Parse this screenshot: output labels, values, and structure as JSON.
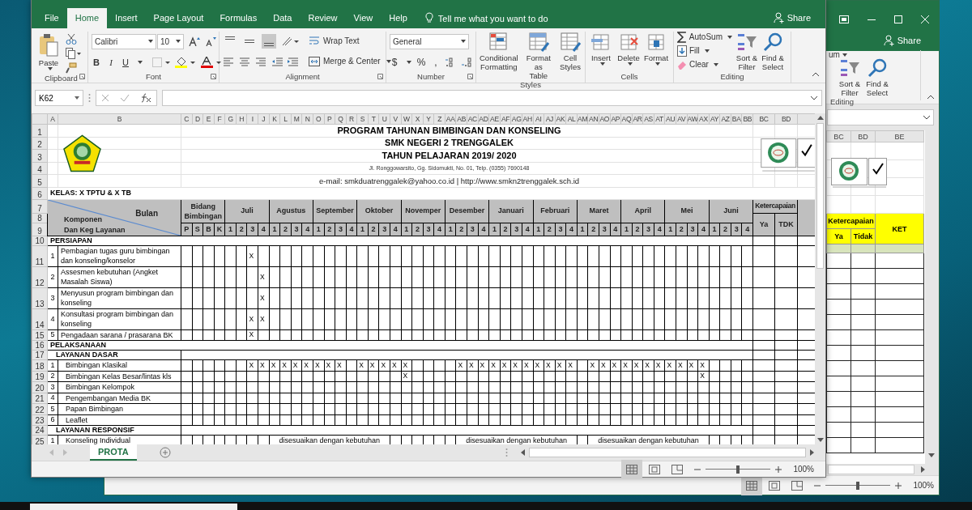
{
  "window": {
    "tabs": [
      {
        "label": "File",
        "selected": false
      },
      {
        "label": "Home",
        "selected": true
      },
      {
        "label": "Insert",
        "selected": false
      },
      {
        "label": "Page Layout",
        "selected": false
      },
      {
        "label": "Formulas",
        "selected": false
      },
      {
        "label": "Data",
        "selected": false
      },
      {
        "label": "Review",
        "selected": false
      },
      {
        "label": "View",
        "selected": false
      },
      {
        "label": "Help",
        "selected": false
      }
    ],
    "tell_me": "Tell me what you want to do",
    "share": "Share"
  },
  "ribbon": {
    "groups": [
      {
        "kind": "clipboard",
        "label": "Clipboard",
        "paste": "Paste"
      },
      {
        "kind": "font",
        "label": "Font",
        "font_name": "Calibri",
        "font_size": "10",
        "bold": "B",
        "italic": "I",
        "underline": "U"
      },
      {
        "kind": "alignment",
        "label": "Alignment",
        "wrap": "Wrap Text",
        "merge": "Merge & Center",
        "vertical_align": [
          {
            "selected": false
          },
          {
            "selected": false
          },
          {
            "selected": true
          }
        ]
      },
      {
        "kind": "number",
        "label": "Number",
        "format": "General",
        "currency": "$",
        "percent": "%",
        "comma": ","
      },
      {
        "kind": "styles",
        "label": "Styles",
        "buttons": [
          "Conditional\nFormatting",
          "Format as\nTable",
          "Cell\nStyles"
        ]
      },
      {
        "kind": "cells",
        "label": "Cells",
        "buttons": [
          "Insert",
          "Delete",
          "Format"
        ]
      },
      {
        "kind": "editing",
        "label": "Editing",
        "items": [
          "AutoSum",
          "Fill",
          "Clear"
        ],
        "buttons": [
          "Sort &\nFilter",
          "Find &\nSelect"
        ]
      }
    ]
  },
  "formula_bar": {
    "name_box": "K62"
  },
  "sheet": {
    "column_headers": [
      "A",
      "B",
      "C",
      "D",
      "E",
      "F",
      "G",
      "H",
      "I",
      "J",
      "K",
      "L",
      "M",
      "N",
      "O",
      "P",
      "Q",
      "R",
      "S",
      "T",
      "U",
      "V",
      "W",
      "X",
      "Y",
      "Z",
      "AA",
      "AB",
      "AC",
      "AD",
      "AE",
      "AF",
      "AG",
      "AH",
      "AI",
      "AJ",
      "AK",
      "AL",
      "AM",
      "AN",
      "AO",
      "AP",
      "AQ",
      "AR",
      "AS",
      "AT",
      "AU",
      "AV",
      "AW",
      "AX",
      "AY",
      "AZ",
      "BA",
      "BB",
      "BC",
      "BD"
    ],
    "top_rows": [
      {
        "n": "1",
        "kind": "title",
        "text": "PROGRAM TAHUNAN BIMBINGAN DAN KONSELING"
      },
      {
        "n": "2",
        "kind": "title",
        "text": "SMK NEGERI 2 TRENGGALEK"
      },
      {
        "n": "3",
        "kind": "title",
        "text": "TAHUN PELAJARAN 2019/ 2020"
      },
      {
        "n": "4",
        "kind": "address",
        "text": "Jl. Ronggowarsito, Gg. Sidomukti, No. 01, Telp. (0355) 7690148"
      },
      {
        "n": "5",
        "kind": "contact",
        "text": "e-mail: smkduatrenggalek@yahoo.co.id | http://www.smkn2trenggalek.sch.id"
      },
      {
        "n": "6",
        "kind": "class",
        "text": "KELAS: X TPTU & X TB"
      }
    ],
    "header": {
      "row_numbers": [
        "7",
        "8",
        "9"
      ],
      "corner_top": "Bulan",
      "corner_bottom": "Komponen\nDan Keg Layanan",
      "field_group": "Bidang Bimbingan",
      "fields": [
        "P",
        "S",
        "B",
        "K"
      ],
      "months": [
        {
          "name": "Juli",
          "weeks": [
            "1",
            "2",
            "3",
            "4"
          ]
        },
        {
          "name": "Agustus",
          "weeks": [
            "1",
            "2",
            "3",
            "4"
          ]
        },
        {
          "name": "September",
          "weeks": [
            "1",
            "2",
            "3",
            "4"
          ]
        },
        {
          "name": "Oktober",
          "weeks": [
            "1",
            "2",
            "3",
            "4"
          ]
        },
        {
          "name": "Novemper",
          "weeks": [
            "1",
            "2",
            "3",
            "4"
          ]
        },
        {
          "name": "Desember",
          "weeks": [
            "1",
            "2",
            "3",
            "4"
          ]
        },
        {
          "name": "Januari",
          "weeks": [
            "1",
            "2",
            "3",
            "4"
          ]
        },
        {
          "name": "Februari",
          "weeks": [
            "1",
            "2",
            "3",
            "4"
          ]
        },
        {
          "name": "Maret",
          "weeks": [
            "1",
            "2",
            "3",
            "4"
          ]
        },
        {
          "name": "April",
          "weeks": [
            "1",
            "2",
            "3",
            "4"
          ]
        },
        {
          "name": "Mei",
          "weeks": [
            "1",
            "2",
            "3",
            "4"
          ]
        },
        {
          "name": "Juni",
          "weeks": [
            "1",
            "2",
            "3",
            "4"
          ]
        }
      ],
      "achievement": "Ketercapaian",
      "yes": "Ya",
      "no": "TDK"
    },
    "body_rows": [
      {
        "n": "10",
        "kind": "section",
        "text": "PERSIAPAN"
      },
      {
        "n": "11",
        "kind": "item",
        "no": "1",
        "label": "Pembagian tugas guru bimbingan dan konseling/konselor",
        "cells": [
          {},
          {},
          {},
          {},
          {},
          {},
          {
            "text": "X"
          }
        ]
      },
      {
        "n": "12",
        "kind": "item",
        "no": "2",
        "label": "Assesmen kebutuhan (Angket Masalah Siswa)",
        "cells": [
          {},
          {},
          {},
          {},
          {},
          {},
          {},
          {
            "text": "X"
          }
        ]
      },
      {
        "n": "13",
        "kind": "item",
        "no": "3",
        "label": "Menyusun program bimbingan dan konseling",
        "cells": [
          {},
          {},
          {},
          {},
          {},
          {},
          {},
          {
            "text": "X"
          }
        ]
      },
      {
        "n": "14",
        "kind": "item",
        "no": "4",
        "label": "Konsultasi program bimbingan dan konseling",
        "cells": [
          {},
          {},
          {},
          {},
          {},
          {},
          {
            "text": "X"
          },
          {
            "text": "X"
          }
        ]
      },
      {
        "n": "15",
        "kind": "item",
        "no": "5",
        "label": "Pengadaan sarana / prasarana BK",
        "cells": [
          {},
          {},
          {},
          {},
          {},
          {},
          {
            "text": "X"
          }
        ]
      },
      {
        "n": "16",
        "kind": "section",
        "text": "PELAKSANAAN"
      },
      {
        "n": "17",
        "kind": "subsection",
        "text": "LAYANAN DASAR"
      },
      {
        "n": "18",
        "kind": "activity",
        "no": "1",
        "label": "Bimbingan Klasikal",
        "cells": [
          {},
          {},
          {},
          {},
          {},
          {},
          {
            "text": "X"
          },
          {
            "text": "X"
          },
          {
            "text": "X"
          },
          {
            "text": "X"
          },
          {
            "text": "X"
          },
          {
            "text": "X"
          },
          {
            "text": "X"
          },
          {
            "text": "X"
          },
          {
            "text": "X"
          },
          {},
          {
            "text": "X"
          },
          {
            "text": "X"
          },
          {
            "text": "X"
          },
          {
            "text": "X"
          },
          {
            "text": "X"
          },
          {},
          {},
          {},
          {},
          {
            "text": "X"
          },
          {
            "text": "X"
          },
          {
            "text": "X"
          },
          {
            "text": "X"
          },
          {
            "text": "X"
          },
          {
            "text": "X"
          },
          {
            "text": "X"
          },
          {
            "text": "X"
          },
          {
            "text": "X"
          },
          {
            "text": "X"
          },
          {
            "text": "X"
          },
          {},
          {
            "text": "X"
          },
          {
            "text": "X"
          },
          {
            "text": "X"
          },
          {
            "text": "X"
          },
          {
            "text": "X"
          },
          {
            "text": "X"
          },
          {
            "text": "X"
          },
          {
            "text": "X"
          },
          {
            "text": "X"
          },
          {
            "text": "X"
          },
          {
            "text": "X"
          }
        ]
      },
      {
        "n": "19",
        "kind": "activity",
        "no": "2",
        "label": "Bimbingan Kelas Besar/lintas kls",
        "cells": [
          {},
          {},
          {},
          {},
          {},
          {},
          {},
          {},
          {},
          {},
          {},
          {},
          {},
          {},
          {},
          {},
          {},
          {},
          {},
          {},
          {
            "text": "X"
          },
          {},
          {},
          {},
          {},
          {},
          {},
          {},
          {},
          {},
          {},
          {},
          {},
          {},
          {},
          {},
          {},
          {},
          {},
          {},
          {},
          {},
          {},
          {},
          {},
          {},
          {},
          {
            "text": "X"
          }
        ]
      },
      {
        "n": "20",
        "kind": "activity",
        "no": "3",
        "label": "Bimbingan Kelompok"
      },
      {
        "n": "21",
        "kind": "activity",
        "no": "4",
        "label": "Pengembangan Media BK"
      },
      {
        "n": "22",
        "kind": "activity",
        "no": "5",
        "label": "Papan Bimbingan"
      },
      {
        "n": "23",
        "kind": "activity",
        "no": "6",
        "label": "Leaflet"
      },
      {
        "n": "24",
        "kind": "subsection",
        "text": "LAYANAN RESPONSIF"
      },
      {
        "n": "25",
        "kind": "activity",
        "no": "1",
        "label": "Konseling Individual",
        "cells": [
          {},
          {},
          {},
          {},
          {},
          {},
          {},
          {},
          {
            "text": "disesuaikan dengan kebutuhan"
          },
          {
            "kind": "merged"
          },
          {
            "kind": "merged"
          },
          {
            "kind": "merged"
          },
          {
            "kind": "merged"
          },
          {
            "kind": "merged"
          },
          {
            "kind": "merged"
          },
          {
            "kind": "merged"
          },
          {
            "kind": "merged"
          },
          {
            "kind": "merged"
          },
          {
            "kind": "merged"
          },
          {},
          {},
          {},
          {},
          {},
          {},
          {
            "text": "disesuaikan dengan kebutuhan"
          },
          {
            "kind": "merged"
          },
          {
            "kind": "merged"
          },
          {
            "kind": "merged"
          },
          {
            "kind": "merged"
          },
          {
            "kind": "merged"
          },
          {
            "kind": "merged"
          },
          {
            "kind": "merged"
          },
          {
            "kind": "merged"
          },
          {
            "kind": "merged"
          },
          {
            "kind": "merged"
          },
          {},
          {
            "text": "disesuaikan dengan kebutuhan"
          },
          {
            "kind": "merged"
          },
          {
            "kind": "merged"
          },
          {
            "kind": "merged"
          },
          {
            "kind": "merged"
          },
          {
            "kind": "merged"
          },
          {
            "kind": "merged"
          },
          {
            "kind": "merged"
          },
          {
            "kind": "merged"
          },
          {
            "kind": "merged"
          },
          {
            "kind": "merged"
          }
        ]
      }
    ]
  },
  "sheet_tabs": [
    {
      "label": "PROTA",
      "selected": true
    }
  ],
  "status_bar": {
    "zoom": "100%",
    "level": 0.5
  },
  "background_window": {
    "share": "Share",
    "autosum_partial": "um",
    "buttons": [
      "Sort &\nFilter",
      "Find &\nSelect"
    ],
    "group_label": "Editing",
    "column_headers": [
      "BC",
      "BD",
      "BE"
    ],
    "achievement": "Ketercapaian",
    "remarks": "KET",
    "yes": "Ya",
    "no": "Tidak",
    "zoom": "100%",
    "level": 0.5
  }
}
